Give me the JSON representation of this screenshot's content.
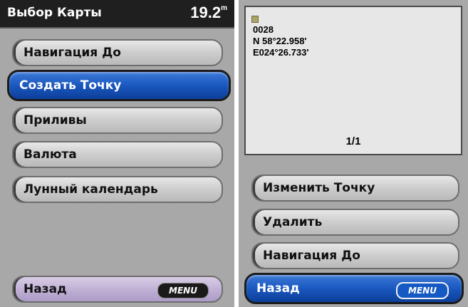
{
  "left_screen": {
    "header": {
      "title": "Выбор Карты",
      "value": "19.2",
      "unit": "m"
    },
    "menu_items": [
      {
        "label": "Навигация До",
        "selected": false
      },
      {
        "label": "Создать Точку",
        "selected": true
      },
      {
        "label": "Приливы",
        "selected": false
      },
      {
        "label": "Валюта",
        "selected": false
      },
      {
        "label": "Лунный календарь",
        "selected": false
      }
    ],
    "back_button": {
      "label": "Назад",
      "key": "MENU"
    }
  },
  "right_screen": {
    "waypoint": {
      "name": "0028",
      "lat": "N  58°22.958'",
      "lon": "E024°26.733'",
      "page": "1/1"
    },
    "menu_items": [
      {
        "label": "Изменить Точку"
      },
      {
        "label": "Удалить"
      },
      {
        "label": "Навигация До"
      }
    ],
    "back_button": {
      "label": "Назад",
      "key": "MENU",
      "selected": true
    }
  },
  "colors": {
    "header_bg": "#1f1f1f",
    "selected_blue": "#1a57c0",
    "panel_bg": "#a8a8a8",
    "back_lilac": "#c1b2d6"
  }
}
